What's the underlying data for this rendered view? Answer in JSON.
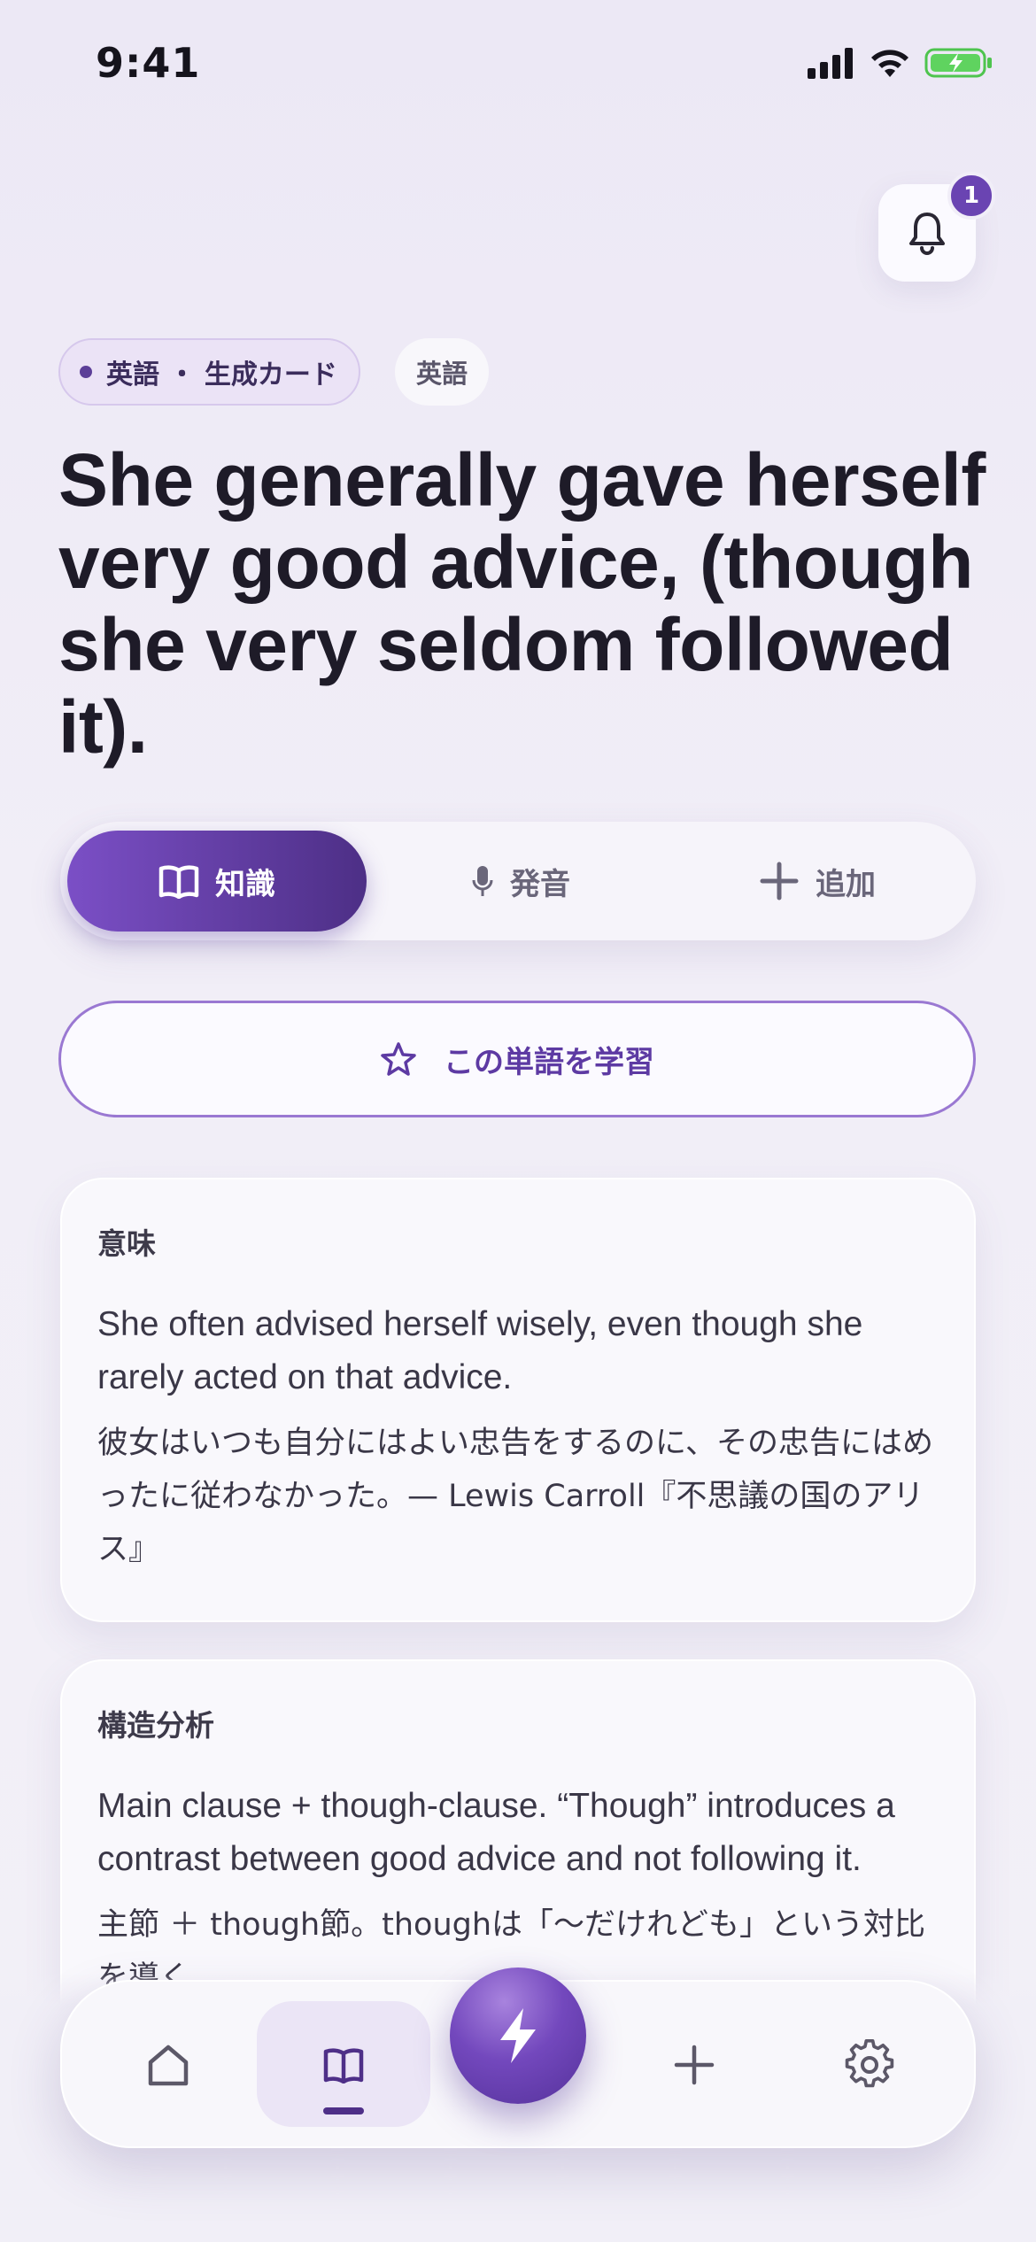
{
  "status_bar": {
    "time": "9:41"
  },
  "notifications": {
    "badge_count": "1"
  },
  "chips": {
    "source_label": "英語 ・ 生成カード",
    "language_label": "英語"
  },
  "headline": "She generally gave herself very good advice, (though she very seldom followed it).",
  "tabs": [
    {
      "label": "知識",
      "icon": "book-icon",
      "active": true
    },
    {
      "label": "発音",
      "icon": "mic-icon",
      "active": false
    },
    {
      "label": "追加",
      "icon": "plus-icon",
      "active": false
    }
  ],
  "study_button": {
    "label": "この単語を学習",
    "icon": "star-icon"
  },
  "cards": [
    {
      "title": "意味",
      "english": "She often advised herself wisely, even though she rarely acted on that advice.",
      "japanese": "彼女はいつも自分にはよい忠告をするのに、その忠告にはめったに従わなかった。— Lewis Carroll『不思議の国のアリス』"
    },
    {
      "title": "構造分析",
      "english": "Main clause + though-clause. “Though” introduces a contrast between good advice and not following it.",
      "japanese": "主節 ＋ though節。thoughは「〜だけれども」という対比を導く。"
    }
  ],
  "bottom_nav": {
    "items": [
      "home-icon",
      "book-icon",
      "bolt-icon",
      "plus-icon",
      "gear-icon"
    ],
    "active": "book-icon"
  },
  "colors": {
    "accent": "#6a44b2",
    "accent_dark": "#4d2f86",
    "background": "#efecf6"
  }
}
